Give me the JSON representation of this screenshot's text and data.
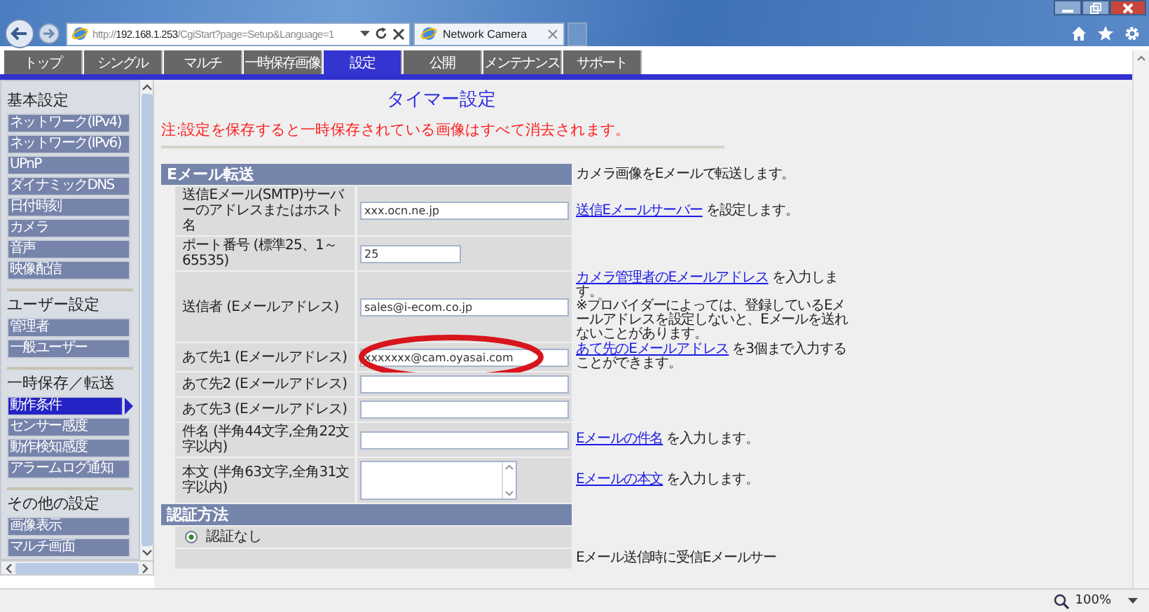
{
  "browser": {
    "address": "http://**192.168.1.253**/CgiStart?page=Setup&Language=1",
    "tab_title": "Network Camera",
    "zoom": "100%"
  },
  "nav_tabs": [
    {
      "label": "トップ",
      "selected": false
    },
    {
      "label": "シングル",
      "selected": false
    },
    {
      "label": "マルチ",
      "selected": false
    },
    {
      "label": "一時保存画像",
      "selected": false
    },
    {
      "label": "設定",
      "selected": true
    },
    {
      "label": "公開",
      "selected": false
    },
    {
      "label": "メンテナンス",
      "selected": false
    },
    {
      "label": "サポート",
      "selected": false
    }
  ],
  "sidebar": [
    {
      "heading": "基本設定",
      "items": [
        {
          "label": "ネットワーク(IPv4)",
          "selected": false
        },
        {
          "label": "ネットワーク(IPv6)",
          "selected": false
        },
        {
          "label": "UPnP",
          "selected": false
        },
        {
          "label": "ダイナミックDNS",
          "selected": false
        },
        {
          "label": "日付時刻",
          "selected": false
        },
        {
          "label": "カメラ",
          "selected": false
        },
        {
          "label": "音声",
          "selected": false
        },
        {
          "label": "映像配信",
          "selected": false
        }
      ]
    },
    {
      "heading": "ユーザー設定",
      "items": [
        {
          "label": "管理者",
          "selected": false
        },
        {
          "label": "一般ユーザー",
          "selected": false
        }
      ]
    },
    {
      "heading": "一時保存／転送",
      "items": [
        {
          "label": "動作条件",
          "selected": true
        },
        {
          "label": "センサー感度",
          "selected": false
        },
        {
          "label": "動作検知感度",
          "selected": false
        },
        {
          "label": "アラームログ通知",
          "selected": false
        }
      ]
    },
    {
      "heading": "その他の設定",
      "items": [
        {
          "label": "画像表示",
          "selected": false
        },
        {
          "label": "マルチ画面",
          "selected": false
        }
      ]
    }
  ],
  "page": {
    "title": "タイマー設定",
    "note": "注:設定を保存すると一時保存されている画像はすべて消去されます。"
  },
  "sections": [
    {
      "heading": "Eメール転送",
      "description": "カメラ画像をEメールで転送します。",
      "rows": [
        {
          "kind": "field",
          "label": "送信Eメール(SMTP)サーバーのアドレスまたはホスト名",
          "value": "xxx.ocn.ne.jp",
          "highlighted": false,
          "description": {
            "link": "送信Eメールサーバー",
            "text": " を設定します。"
          }
        },
        {
          "kind": "short_field",
          "label": "ポート番号 (標準25、1～65535)",
          "value": "25",
          "highlighted": false
        },
        {
          "kind": "field",
          "label": "送信者 (Eメールアドレス)",
          "value": "sales@i-ecom.co.jp",
          "highlighted": false,
          "description": {
            "link": "カメラ管理者のEメールアドレス",
            "text": " を入力します。",
            "note": "※プロバイダーによっては、登録しているEメールアドレスを設定しないと、Eメールを送れないことがあります。"
          }
        },
        {
          "kind": "field",
          "label": "あて先1 (Eメールアドレス)",
          "value": "xxxxxxx@cam.oyasai.com",
          "highlighted": true,
          "description": {
            "link": "あて先のEメールアドレス",
            "text": " を3個まで入力することができます。"
          }
        },
        {
          "kind": "field",
          "label": "あて先2 (Eメールアドレス)",
          "highlighted": false
        },
        {
          "kind": "field",
          "label": "あて先3 (Eメールアドレス)",
          "highlighted": false
        },
        {
          "kind": "field",
          "label": "件名 (半角44文字,全角22文字以内)",
          "highlighted": false,
          "description": {
            "link": "Eメールの件名",
            "text": " を入力します。"
          }
        },
        {
          "kind": "textarea",
          "label": "本文 (半角63文字,全角31文字以内)",
          "highlighted": false,
          "description": {
            "link": "Eメールの本文",
            "text": " を入力します。"
          }
        }
      ]
    },
    {
      "heading": "認証方法",
      "rows": [
        {
          "kind": "radio",
          "label": "認証なし",
          "selected": true,
          "highlighted": false
        },
        {
          "kind": "blank",
          "highlighted": false,
          "description": {
            "text": "Eメール送信時に受信Eメールサー"
          }
        }
      ]
    }
  ]
}
